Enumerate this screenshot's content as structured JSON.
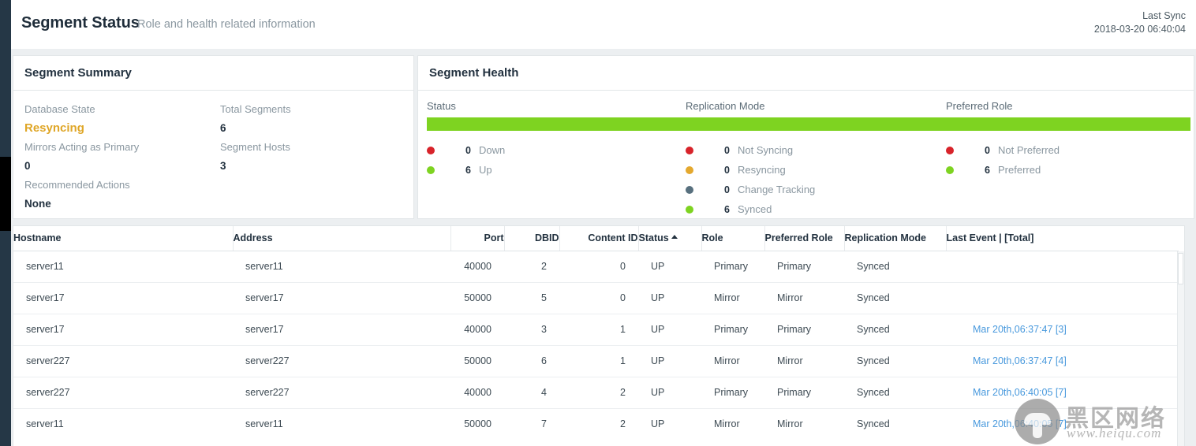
{
  "header": {
    "title": "Segment Status",
    "subtitle": "Role and health related information",
    "last_sync_label": "Last Sync",
    "last_sync_value": "2018-03-20 06:40:04"
  },
  "summary": {
    "card_title": "Segment Summary",
    "fields": [
      {
        "label": "Database State",
        "value": "Resyncing",
        "style": "gold"
      },
      {
        "label": "Total Segments",
        "value": "6",
        "style": "normal"
      },
      {
        "label": "Mirrors Acting as Primary",
        "value": "0",
        "style": "normal"
      },
      {
        "label": "Segment Hosts",
        "value": "3",
        "style": "normal"
      },
      {
        "label": "Recommended Actions",
        "value": "None",
        "style": "normal"
      }
    ],
    "col_a": {
      "l1": "Database State",
      "v1": "Resyncing",
      "l2": "Mirrors Acting as Primary",
      "v2": "0",
      "l3": "Recommended Actions",
      "v3": "None"
    },
    "col_b": {
      "l1": "Total Segments",
      "v1": "6",
      "l2": "Segment Hosts",
      "v2": "3"
    }
  },
  "health": {
    "card_title": "Segment Health",
    "bar_color": "#7ed321",
    "columns": [
      {
        "title": "Status",
        "legend": [
          {
            "count": "0",
            "label": "Down",
            "color": "#d8232a"
          },
          {
            "count": "6",
            "label": "Up",
            "color": "#7ed321"
          }
        ]
      },
      {
        "title": "Replication Mode",
        "legend": [
          {
            "count": "0",
            "label": "Not Syncing",
            "color": "#d8232a"
          },
          {
            "count": "0",
            "label": "Resyncing",
            "color": "#e4a82e"
          },
          {
            "count": "0",
            "label": "Change Tracking",
            "color": "#58707e"
          },
          {
            "count": "6",
            "label": "Synced",
            "color": "#7ed321"
          }
        ]
      },
      {
        "title": "Preferred Role",
        "legend": [
          {
            "count": "0",
            "label": "Not Preferred",
            "color": "#d8232a"
          },
          {
            "count": "6",
            "label": "Preferred",
            "color": "#7ed321"
          }
        ]
      }
    ]
  },
  "table": {
    "columns": [
      "Hostname",
      "Address",
      "Port",
      "DBID",
      "Content ID",
      "Status",
      "Role",
      "Preferred Role",
      "Replication Mode",
      "Last Event | [Total]"
    ],
    "sort_column": "Status",
    "sort_direction": "asc",
    "rows": [
      {
        "hostname": "server11",
        "address": "server11",
        "port": "40000",
        "dbid": "2",
        "content_id": "0",
        "status": "UP",
        "role": "Primary",
        "preferred_role": "Primary",
        "replication_mode": "Synced",
        "last_event": ""
      },
      {
        "hostname": "server17",
        "address": "server17",
        "port": "50000",
        "dbid": "5",
        "content_id": "0",
        "status": "UP",
        "role": "Mirror",
        "preferred_role": "Mirror",
        "replication_mode": "Synced",
        "last_event": ""
      },
      {
        "hostname": "server17",
        "address": "server17",
        "port": "40000",
        "dbid": "3",
        "content_id": "1",
        "status": "UP",
        "role": "Primary",
        "preferred_role": "Primary",
        "replication_mode": "Synced",
        "last_event": "Mar 20th,06:37:47  [3]"
      },
      {
        "hostname": "server227",
        "address": "server227",
        "port": "50000",
        "dbid": "6",
        "content_id": "1",
        "status": "UP",
        "role": "Mirror",
        "preferred_role": "Mirror",
        "replication_mode": "Synced",
        "last_event": "Mar 20th,06:37:47  [4]"
      },
      {
        "hostname": "server227",
        "address": "server227",
        "port": "40000",
        "dbid": "4",
        "content_id": "2",
        "status": "UP",
        "role": "Primary",
        "preferred_role": "Primary",
        "replication_mode": "Synced",
        "last_event": "Mar 20th,06:40:05  [7]"
      },
      {
        "hostname": "server11",
        "address": "server11",
        "port": "50000",
        "dbid": "7",
        "content_id": "2",
        "status": "UP",
        "role": "Mirror",
        "preferred_role": "Mirror",
        "replication_mode": "Synced",
        "last_event": "Mar 20th,06:40:05  [7]"
      }
    ]
  },
  "watermark": {
    "text_cn": "黑区网络",
    "text_url": "www.heiqu.com"
  }
}
